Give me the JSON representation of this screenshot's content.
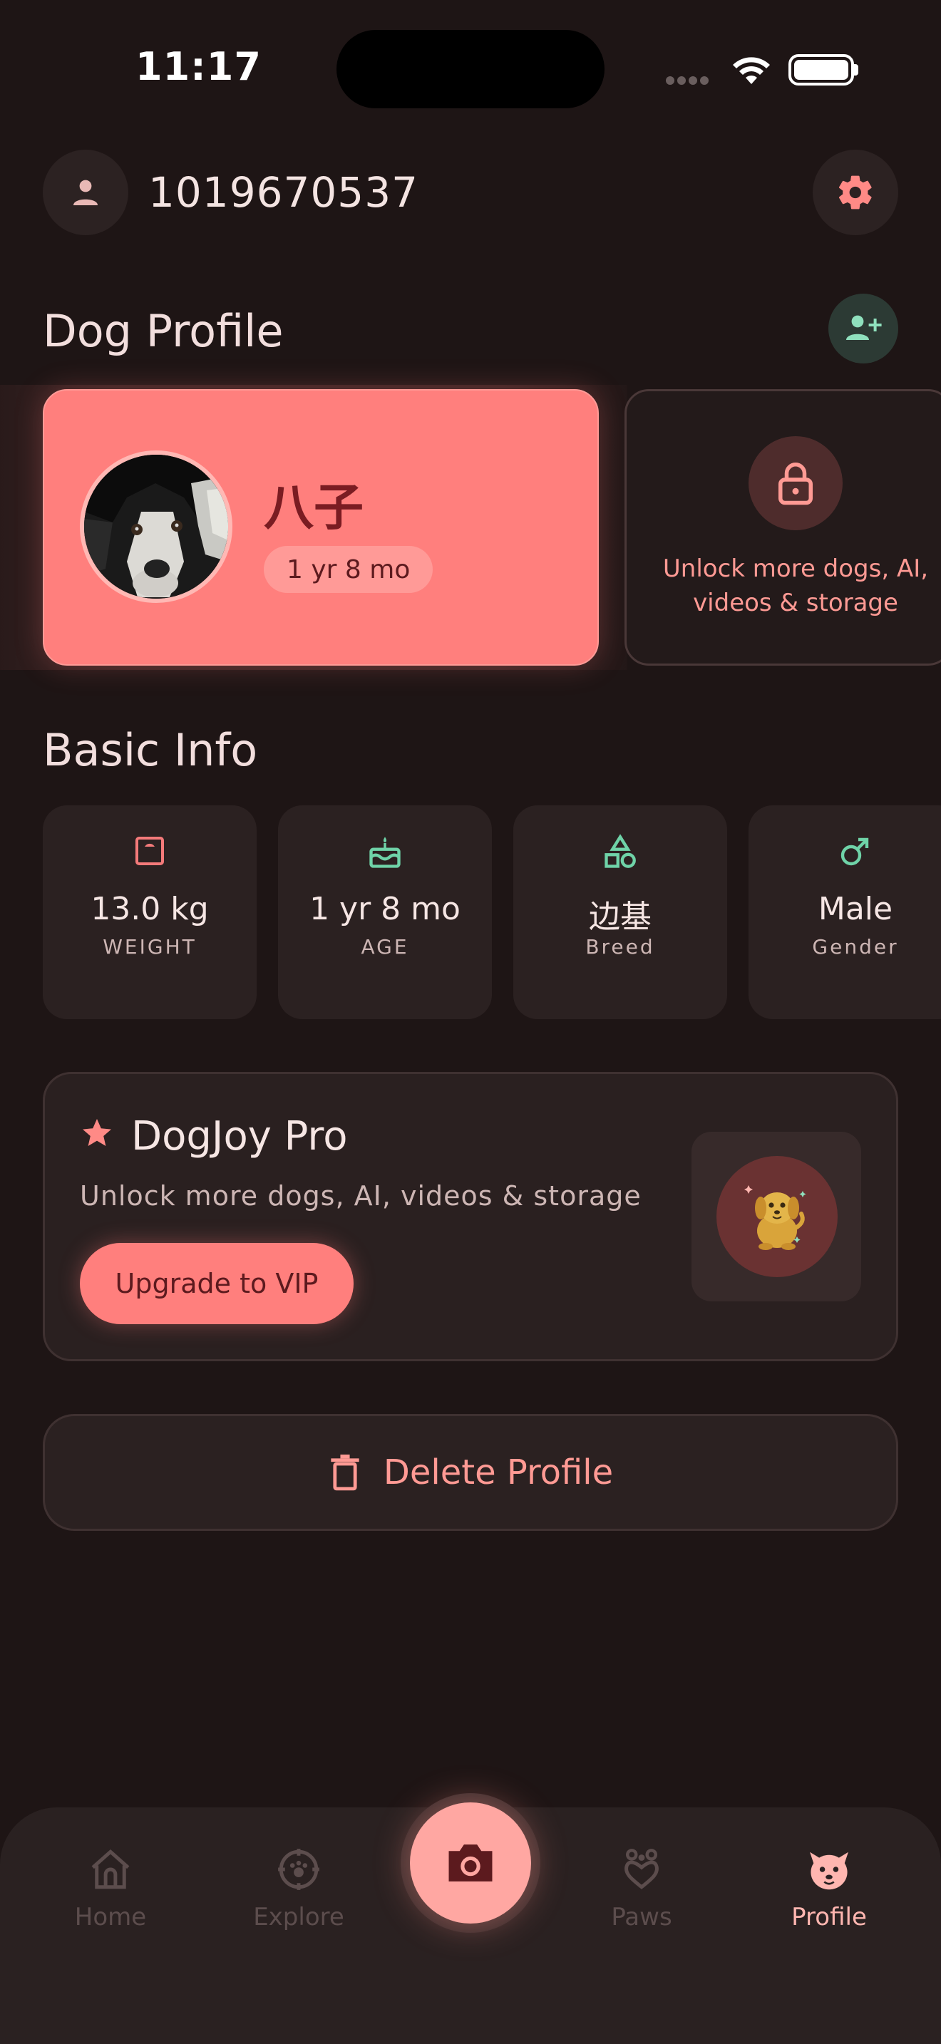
{
  "status_bar": {
    "time": "11:17"
  },
  "header": {
    "user_id": "1019670537"
  },
  "dog_profile": {
    "title": "Dog Profile",
    "dog": {
      "name": "八子",
      "age": "1 yr 8 mo"
    },
    "locked_card_text": "Unlock more dogs, AI, videos & storage"
  },
  "basic_info": {
    "title": "Basic Info",
    "items": [
      {
        "value": "13.0 kg",
        "label": "WEIGHT",
        "icon": "scale-icon",
        "color": "#f47a7a"
      },
      {
        "value": "1 yr 8 mo",
        "label": "AGE",
        "icon": "cake-icon",
        "color": "#6fd3a8"
      },
      {
        "value": "边基",
        "label": "Breed",
        "icon": "shapes-icon",
        "color": "#6fd3a8"
      },
      {
        "value": "Male",
        "label": "Gender",
        "icon": "male-icon",
        "color": "#6fd3a8"
      }
    ]
  },
  "pro": {
    "title": "DogJoy Pro",
    "subtitle": "Unlock more dogs, AI, videos & storage",
    "button": "Upgrade to VIP"
  },
  "delete_button": "Delete Profile",
  "nav": {
    "items": [
      {
        "label": "Home",
        "icon": "home-icon"
      },
      {
        "label": "Explore",
        "icon": "explore-icon"
      },
      {
        "label": "Paws",
        "icon": "paws-icon"
      },
      {
        "label": "Profile",
        "icon": "dog-face-icon",
        "active": true
      }
    ],
    "camera_icon": "camera-icon"
  },
  "colors": {
    "background": "#1e1515",
    "accent": "#ff7f7d",
    "secondary": "#6fd3a8"
  }
}
